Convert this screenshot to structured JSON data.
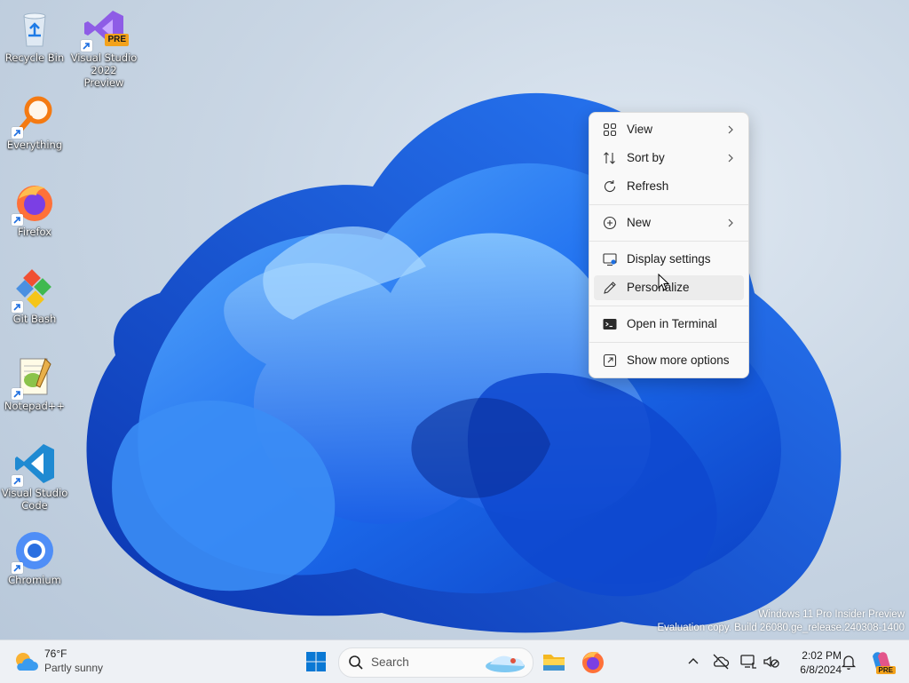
{
  "desktop": {
    "icons": [
      {
        "label": "Recycle Bin"
      },
      {
        "label": "Visual Studio 2022 Preview",
        "badge": "PRE"
      },
      {
        "label": "Everything"
      },
      {
        "label": "Firefox"
      },
      {
        "label": "Git Bash"
      },
      {
        "label": "Notepad++"
      },
      {
        "label": "Visual Studio Code"
      },
      {
        "label": "Chromium"
      }
    ]
  },
  "context_menu": {
    "items": [
      {
        "label": "View",
        "icon": "grid-icon",
        "submenu": true
      },
      {
        "label": "Sort by",
        "icon": "sort-icon",
        "submenu": true
      },
      {
        "label": "Refresh",
        "icon": "refresh-icon",
        "submenu": false
      },
      {
        "label": "New",
        "icon": "plus-circle-icon",
        "submenu": true
      },
      {
        "label": "Display settings",
        "icon": "display-icon",
        "submenu": false
      },
      {
        "label": "Personalize",
        "icon": "pen-icon",
        "submenu": false,
        "hovered": true
      },
      {
        "label": "Open in Terminal",
        "icon": "terminal-icon",
        "submenu": false
      },
      {
        "label": "Show more options",
        "icon": "external-icon",
        "submenu": false
      }
    ]
  },
  "watermark": {
    "line1": "Windows 11 Pro Insider Preview",
    "line2": "Evaluation copy. Build 26080.ge_release.240308-1400"
  },
  "taskbar": {
    "weather": {
      "temp": "76°F",
      "desc": "Partly sunny"
    },
    "search_placeholder": "Search",
    "clock": {
      "time": "2:02 PM",
      "date": "6/8/2024"
    },
    "copilot_badge": "PRE"
  },
  "colors": {
    "accent": "#0067c0",
    "wallpaper_blue": "#1e6ff0",
    "menu_bg": "#f9f9f9",
    "taskbar_bg": "#eef1f5"
  }
}
